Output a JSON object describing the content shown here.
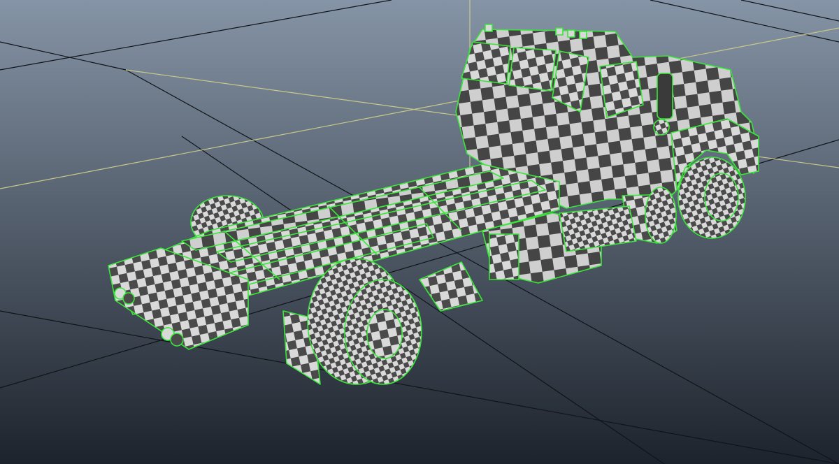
{
  "viewport": {
    "background_top": "#8594a6",
    "background_bottom": "#1d232c",
    "grid_color": "#101418",
    "axis_color": "#c9c98a"
  },
  "model": {
    "wireframe_color": "#39e639",
    "checker_dark": "#4a4a4a",
    "checker_light": "#d9d9d9"
  }
}
